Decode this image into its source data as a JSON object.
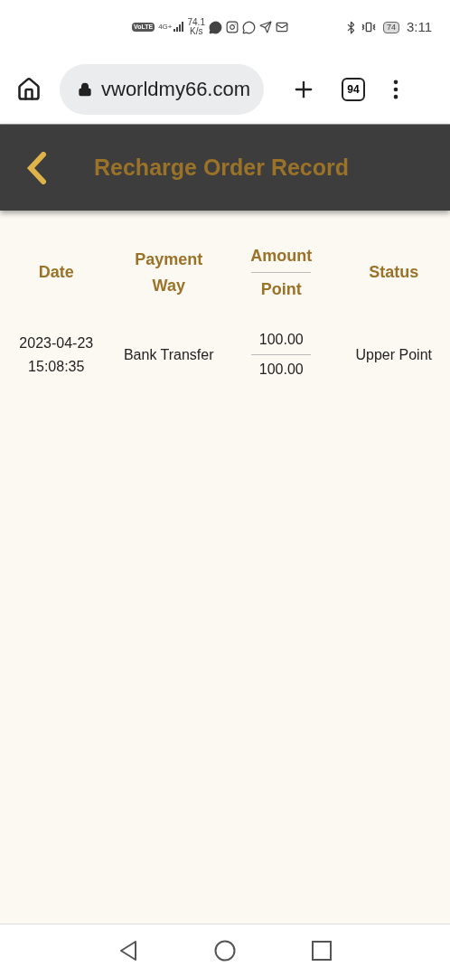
{
  "status_bar": {
    "network_badge": "VoLTE",
    "network_type": "4G+",
    "speed_value": "74.1",
    "speed_unit": "K/s",
    "battery": "74",
    "time": "3:11"
  },
  "browser": {
    "url": "vworldmy66.com",
    "tab_count": "94"
  },
  "header": {
    "title": "Recharge Order Record"
  },
  "table": {
    "columns": [
      {
        "kind": "single",
        "label": "Date"
      },
      {
        "kind": "single",
        "label": "Payment Way"
      },
      {
        "kind": "split",
        "top": "Amount",
        "bottom": "Point"
      },
      {
        "kind": "single",
        "label": "Status"
      }
    ],
    "rows": [
      {
        "date": "2023-04-23 15:08:35",
        "payment_way": "Bank Transfer",
        "amount": "100.00",
        "point": "100.00",
        "status": "Upper Point"
      }
    ]
  }
}
